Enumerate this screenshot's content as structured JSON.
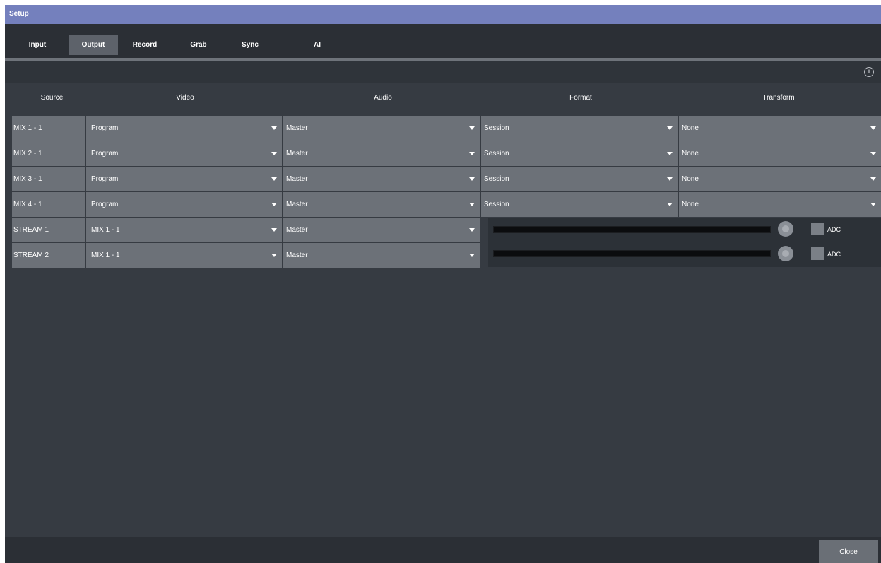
{
  "window": {
    "title": "Setup"
  },
  "tabs": [
    {
      "label": "Input"
    },
    {
      "label": "Output"
    },
    {
      "label": "Record"
    },
    {
      "label": "Grab"
    },
    {
      "label": "Sync"
    },
    {
      "label": "AI"
    }
  ],
  "active_tab": "Output",
  "columns": [
    "Source",
    "Video",
    "Audio",
    "Format",
    "Transform"
  ],
  "rows": [
    {
      "source": "MIX 1 - 1",
      "video": "Program",
      "audio": "Master",
      "format": "Session",
      "transform": "None"
    },
    {
      "source": "MIX 2 - 1",
      "video": "Program",
      "audio": "Master",
      "format": "Session",
      "transform": "None"
    },
    {
      "source": "MIX 3 - 1",
      "video": "Program",
      "audio": "Master",
      "format": "Session",
      "transform": "None"
    },
    {
      "source": "MIX 4 - 1",
      "video": "Program",
      "audio": "Master",
      "format": "Session",
      "transform": "None"
    }
  ],
  "streams": [
    {
      "source": "STREAM 1",
      "video": "MIX 1 - 1",
      "audio": "Master",
      "checkbox_label": "ADC"
    },
    {
      "source": "STREAM 2",
      "video": "MIX 1 - 1",
      "audio": "Master",
      "checkbox_label": "ADC"
    }
  ],
  "footer": {
    "close_label": "Close"
  },
  "colors": {
    "titlebar": "#7480bd",
    "background": "#363b42",
    "cell": "#6c7178"
  }
}
